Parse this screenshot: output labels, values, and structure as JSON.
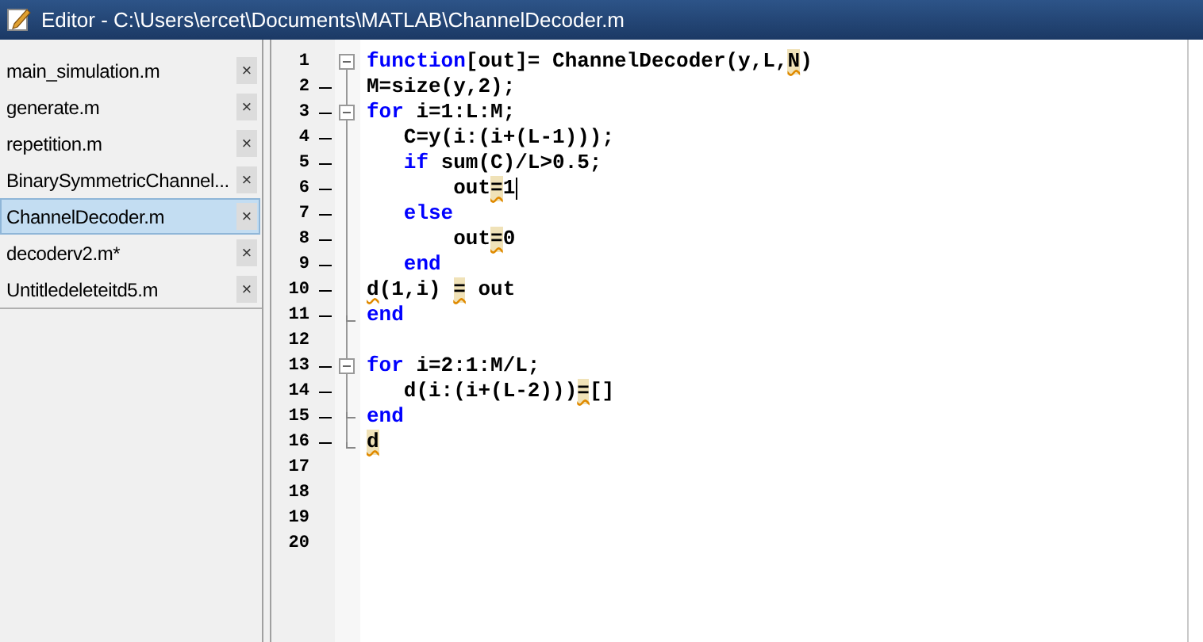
{
  "window": {
    "title": "Editor - C:\\Users\\ercet\\Documents\\MATLAB\\ChannelDecoder.m"
  },
  "files": [
    {
      "name": "main_simulation.m",
      "selected": false
    },
    {
      "name": "generate.m",
      "selected": false
    },
    {
      "name": "repetition.m",
      "selected": false
    },
    {
      "name": "BinarySymmetricChannel...",
      "selected": false
    },
    {
      "name": "ChannelDecoder.m",
      "selected": true
    },
    {
      "name": "decoderv2.m*",
      "selected": false
    },
    {
      "name": "Untitledeleteitd5.m",
      "selected": false
    }
  ],
  "close_glyph": "×",
  "lines": [
    {
      "number": "1",
      "dash": false,
      "fold_box": true,
      "tokens": [
        {
          "kind": "kw",
          "text": "function"
        },
        {
          "kind": "code",
          "text": "[out]= ChannelDecoder(y,L,"
        },
        {
          "kind": "mark",
          "text": "N"
        },
        {
          "kind": "code",
          "text": ")"
        }
      ]
    },
    {
      "number": "2",
      "dash": true,
      "tokens": [
        {
          "kind": "code",
          "text": "M=size(y,2);"
        }
      ]
    },
    {
      "number": "3",
      "dash": true,
      "fold_box": true,
      "tokens": [
        {
          "kind": "kw",
          "text": "for"
        },
        {
          "kind": "code",
          "text": " i=1:L:M;"
        }
      ]
    },
    {
      "number": "4",
      "dash": true,
      "tokens": [
        {
          "kind": "code",
          "text": "   C=y(i:(i+(L-1)));"
        }
      ]
    },
    {
      "number": "5",
      "dash": true,
      "tokens": [
        {
          "kind": "kw",
          "text": "   if"
        },
        {
          "kind": "code",
          "text": " sum(C)/L>0.5;"
        }
      ]
    },
    {
      "number": "6",
      "dash": true,
      "caret": true,
      "tokens": [
        {
          "kind": "code",
          "text": "       out"
        },
        {
          "kind": "mark",
          "text": "="
        },
        {
          "kind": "code",
          "text": "1"
        }
      ]
    },
    {
      "number": "7",
      "dash": true,
      "tokens": [
        {
          "kind": "kw",
          "text": "   else"
        }
      ]
    },
    {
      "number": "8",
      "dash": true,
      "tokens": [
        {
          "kind": "code",
          "text": "       out"
        },
        {
          "kind": "mark",
          "text": "="
        },
        {
          "kind": "code",
          "text": "0"
        }
      ]
    },
    {
      "number": "9",
      "dash": true,
      "tokens": [
        {
          "kind": "kw",
          "text": "   end"
        }
      ]
    },
    {
      "number": "10",
      "dash": true,
      "tokens": [
        {
          "kind": "warn",
          "text": "d"
        },
        {
          "kind": "code",
          "text": "(1,i) "
        },
        {
          "kind": "mark",
          "text": "="
        },
        {
          "kind": "code",
          "text": " out"
        }
      ]
    },
    {
      "number": "11",
      "dash": true,
      "fold_end": true,
      "tokens": [
        {
          "kind": "kw",
          "text": "end"
        }
      ]
    },
    {
      "number": "12",
      "dash": false
    },
    {
      "number": "13",
      "dash": true,
      "fold_box": true,
      "tokens": [
        {
          "kind": "kw",
          "text": "for"
        },
        {
          "kind": "code",
          "text": " i=2:1:M/L;"
        }
      ]
    },
    {
      "number": "14",
      "dash": true,
      "tokens": [
        {
          "kind": "code",
          "text": "   d(i:(i+(L-2)))"
        },
        {
          "kind": "mark",
          "text": "="
        },
        {
          "kind": "code",
          "text": "[]"
        }
      ]
    },
    {
      "number": "15",
      "dash": true,
      "fold_end": true,
      "tokens": [
        {
          "kind": "kw",
          "text": "end"
        }
      ]
    },
    {
      "number": "16",
      "dash": true,
      "fold_end": true,
      "tokens": [
        {
          "kind": "mark",
          "text": "d"
        }
      ]
    },
    {
      "number": "17",
      "dash": false
    },
    {
      "number": "18",
      "dash": false
    },
    {
      "number": "19",
      "dash": false
    },
    {
      "number": "20",
      "dash": false
    }
  ]
}
